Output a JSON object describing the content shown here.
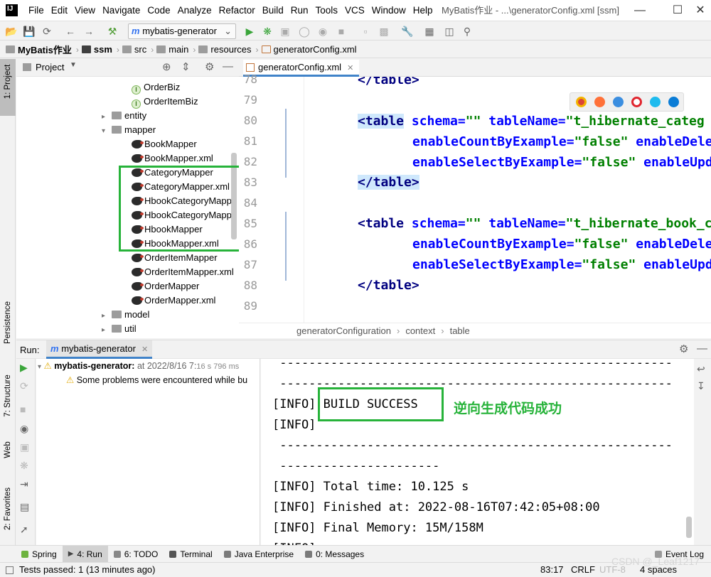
{
  "window": {
    "title": "MyBatis作业 - ...\\generatorConfig.xml [ssm]",
    "menus": [
      "File",
      "Edit",
      "View",
      "Navigate",
      "Code",
      "Analyze",
      "Refactor",
      "Build",
      "Run",
      "Tools",
      "VCS",
      "Window",
      "Help"
    ]
  },
  "toolbar": {
    "run_config": "mybatis-generator"
  },
  "breadcrumb": [
    "MyBatis作业",
    "ssm",
    "src",
    "main",
    "resources",
    "generatorConfig.xml"
  ],
  "left_strip": {
    "project": "1: Project",
    "persistence": "Persistence",
    "structure": "7: Structure",
    "web": "Web",
    "favorites": "2: Favorites"
  },
  "project_panel": {
    "title": "Project",
    "items": [
      {
        "label": "OrderBiz",
        "kind": "interface"
      },
      {
        "label": "OrderItemBiz",
        "kind": "interface"
      },
      {
        "label": "entity",
        "kind": "folder"
      },
      {
        "label": "mapper",
        "kind": "folder"
      },
      {
        "label": "BookMapper",
        "kind": "mybatis"
      },
      {
        "label": "BookMapper.xml",
        "kind": "mybatis"
      },
      {
        "label": "CategoryMapper",
        "kind": "mybatis"
      },
      {
        "label": "CategoryMapper.xml",
        "kind": "mybatis"
      },
      {
        "label": "HbookCategoryMappe",
        "kind": "mybatis"
      },
      {
        "label": "HbookCategoryMappe",
        "kind": "mybatis"
      },
      {
        "label": "HbookMapper",
        "kind": "mybatis"
      },
      {
        "label": "HbookMapper.xml",
        "kind": "mybatis"
      },
      {
        "label": "OrderItemMapper",
        "kind": "mybatis"
      },
      {
        "label": "OrderItemMapper.xml",
        "kind": "mybatis"
      },
      {
        "label": "OrderMapper",
        "kind": "mybatis"
      },
      {
        "label": "OrderMapper.xml",
        "kind": "mybatis"
      },
      {
        "label": "model",
        "kind": "folder"
      },
      {
        "label": "util",
        "kind": "folder"
      }
    ]
  },
  "editor": {
    "tab": "generatorConfig.xml",
    "line_numbers": [
      "78",
      "79",
      "80",
      "81",
      "82",
      "83",
      "84",
      "85",
      "86",
      "87",
      "88",
      "89"
    ],
    "lines": [
      {
        "t": "</table>"
      },
      {
        "t": ""
      },
      {
        "t1": "<table",
        "a1": " schema=",
        "s1": "\"\"",
        "a2": " tableName=",
        "s2": "\"t_hibernate_categ"
      },
      {
        "a1": "enableCountByExample=",
        "s1": "\"false\"",
        "a2": " enableDele"
      },
      {
        "a1": "enableSelectByExample=",
        "s1": "\"false\"",
        "a2": " enableUpd"
      },
      {
        "t": "</table>"
      },
      {
        "t": ""
      },
      {
        "t1": "<table",
        "a1": " schema=",
        "s1": "\"\"",
        "a2": " tableName=",
        "s2": "\"t_hibernate_book_c"
      },
      {
        "a1": "enableCountByExample=",
        "s1": "\"false\"",
        "a2": " enableDele"
      },
      {
        "a1": "enableSelectByExample=",
        "s1": "\"false\"",
        "a2": " enableUpd"
      },
      {
        "t": "</table>"
      },
      {
        "t": ""
      }
    ],
    "crumbs": [
      "generatorConfiguration",
      "context",
      "table"
    ]
  },
  "run_panel": {
    "label": "Run:",
    "tab": "mybatis-generator",
    "tree_root": "mybatis-generator:",
    "tree_root_time": "at 2022/8/16 7:",
    "tree_root_duration": "16 s 796 ms",
    "tree_child": "Some problems were encountered while bu",
    "console": [
      " ------------------------------------------------------",
      " ------------------------------------------------------",
      "[INFO] BUILD SUCCESS",
      "[INFO]",
      " ------------------------------------------------------",
      " ----------------------",
      "[INFO] Total time: 10.125 s",
      "[INFO] Finished at: 2022-08-16T07:42:05+08:00",
      "[INFO] Final Memory: 15M/158M",
      "[INFO]"
    ],
    "annotation": "逆向生成代码成功"
  },
  "bottom_tabs": [
    "Spring",
    "4: Run",
    "6: TODO",
    "Terminal",
    "Java Enterprise",
    "0: Messages"
  ],
  "event_log": "Event Log",
  "status": {
    "message": "Tests passed: 1 (13 minutes ago)",
    "position": "83:17",
    "line_sep": "CRLF",
    "encoding": "UTF-8",
    "indent": "4 spaces",
    "watermark": "CSDN @_Leaf1217"
  }
}
